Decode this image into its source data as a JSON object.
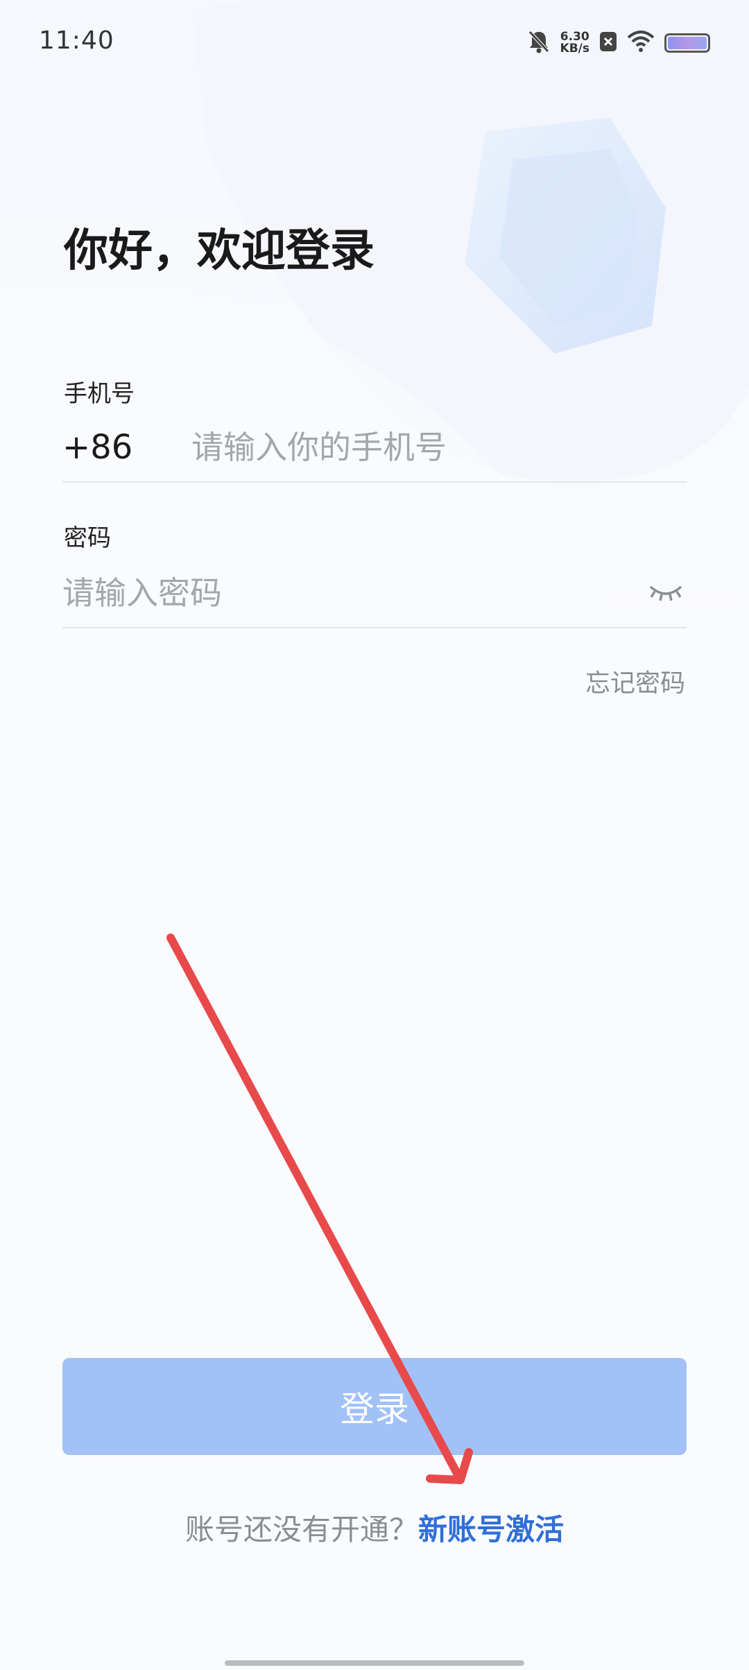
{
  "status_bar": {
    "time": "11:40",
    "net_speed_value": "6.30",
    "net_speed_unit": "KB/s",
    "icons": [
      "mute-bell-icon",
      "close-box-icon",
      "wifi-icon",
      "battery-icon"
    ]
  },
  "login": {
    "title": "你好，欢迎登录",
    "phone_label": "手机号",
    "country_code": "+86",
    "phone_placeholder": "请输入你的手机号",
    "phone_value": "",
    "password_label": "密码",
    "password_placeholder": "请输入密码",
    "password_value": "",
    "forgot_password": "忘记密码",
    "login_button": "登录",
    "activate_question": "账号还没有开通？",
    "activate_link": "新账号激活"
  },
  "colors": {
    "accent": "#2f6fd8",
    "button_disabled": "#a1c1f7",
    "annotation_arrow": "#e8494a"
  }
}
